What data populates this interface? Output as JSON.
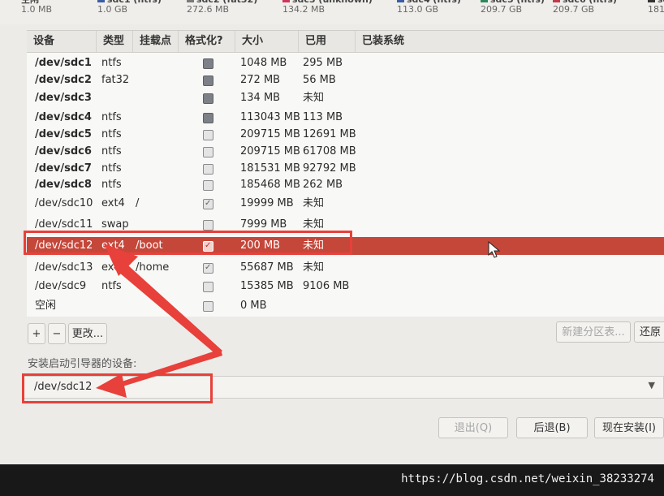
{
  "legend": [
    {
      "name": "空闲",
      "size": "1.0 MB",
      "color": ""
    },
    {
      "name": "sdc1 (ntfs)",
      "size": "1.0 GB",
      "color": "#3b5da8"
    },
    {
      "name": "sdc2 (fat32)",
      "size": "272.6 MB",
      "color": "#7a7a7a"
    },
    {
      "name": "sdc3 (unknown)",
      "size": "134.2 MB",
      "color": "#d0345a"
    },
    {
      "name": "sdc4 (ntfs)",
      "size": "113.0 GB",
      "color": "#3b5da8"
    },
    {
      "name": "sdc5 (ntfs)",
      "size": "209.7 GB",
      "color": "#2b8a5a"
    },
    {
      "name": "sdc6 (ntfs)",
      "size": "209.7 GB",
      "color": "#c23a4a"
    },
    {
      "name": "sdc",
      "size": "181",
      "color": "#333333"
    }
  ],
  "table": {
    "headers": [
      "设备",
      "类型",
      "挂载点",
      "格式化?",
      "大小",
      "已用",
      "已装系统"
    ],
    "rows": [
      {
        "device": "/dev/sdc1",
        "type": "ntfs",
        "mount": "",
        "format": "dark",
        "size": "1048 MB",
        "used": "295 MB"
      },
      {
        "device": "/dev/sdc2",
        "type": "fat32",
        "mount": "",
        "format": "dark",
        "size": "272 MB",
        "used": "56 MB"
      },
      {
        "device": "/dev/sdc3",
        "type": "",
        "mount": "",
        "format": "dark",
        "size": "134 MB",
        "used": "未知"
      },
      {
        "device": "/dev/sdc4",
        "type": "ntfs",
        "mount": "",
        "format": "dark",
        "size": "113043 MB",
        "used": "113 MB"
      },
      {
        "device": "/dev/sdc5",
        "type": "ntfs",
        "mount": "",
        "format": "light",
        "size": "209715 MB",
        "used": "12691 MB"
      },
      {
        "device": "/dev/sdc6",
        "type": "ntfs",
        "mount": "",
        "format": "light",
        "size": "209715 MB",
        "used": "61708 MB"
      },
      {
        "device": "/dev/sdc7",
        "type": "ntfs",
        "mount": "",
        "format": "light",
        "size": "181531 MB",
        "used": "92792 MB"
      },
      {
        "device": "/dev/sdc8",
        "type": "ntfs",
        "mount": "",
        "format": "light",
        "size": "185468 MB",
        "used": "262 MB"
      },
      {
        "device": "/dev/sdc10",
        "type": "ext4",
        "mount": "/",
        "format": "on",
        "size": "19999 MB",
        "used": "未知"
      },
      {
        "device": "/dev/sdc11",
        "type": "swap",
        "mount": "",
        "format": "light",
        "size": "7999 MB",
        "used": "未知"
      },
      {
        "device": "/dev/sdc12",
        "type": "ext4",
        "mount": "/boot",
        "format": "on",
        "size": "200 MB",
        "used": "未知"
      },
      {
        "device": "/dev/sdc13",
        "type": "ext4",
        "mount": "/home",
        "format": "on",
        "size": "55687 MB",
        "used": "未知"
      },
      {
        "device": "/dev/sdc9",
        "type": "ntfs",
        "mount": "",
        "format": "light",
        "size": "15385 MB",
        "used": "9106 MB"
      },
      {
        "device": "空闲",
        "type": "",
        "mount": "",
        "format": "light",
        "size": "0 MB",
        "used": ""
      }
    ],
    "selected_row": 10
  },
  "controls": {
    "add_label": "+",
    "remove_label": "−",
    "change_label": "更改...",
    "new_table_label": "新建分区表...",
    "revert_label": "还原"
  },
  "loader": {
    "label": "安装启动引导器的设备:",
    "value": "/dev/sdc12"
  },
  "footer": {
    "quit_label": "退出(Q)",
    "back_label": "后退(B)",
    "install_label": "现在安装(I)"
  },
  "watermark": "https://blog.csdn.net/weixin_38233274",
  "colors": {
    "selection": "#c4473a",
    "annotation": "#e8403a"
  }
}
